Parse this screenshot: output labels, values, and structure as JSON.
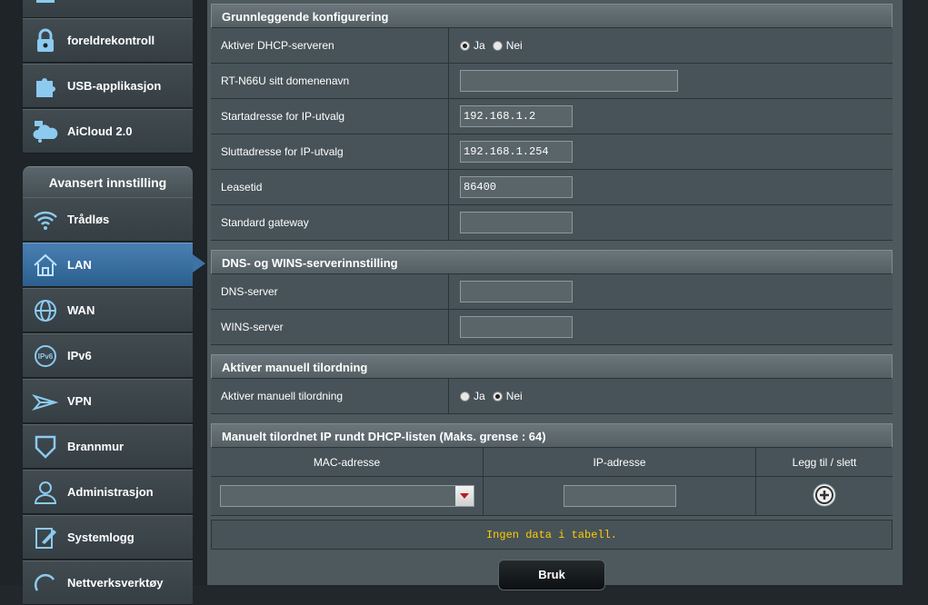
{
  "sidebar": {
    "top_items": [
      {
        "label": "",
        "icon": "partial-icon"
      },
      {
        "label": "foreldrekontroll",
        "icon": "lock-icon"
      },
      {
        "label": "USB-applikasjon",
        "icon": "puzzle-icon"
      },
      {
        "label": "AiCloud 2.0",
        "icon": "cloud-icon"
      }
    ],
    "advanced_header": "Avansert innstilling",
    "items": [
      {
        "label": "Trådløs",
        "icon": "wifi-icon"
      },
      {
        "label": "LAN",
        "icon": "home-icon",
        "active": true
      },
      {
        "label": "WAN",
        "icon": "globe-icon"
      },
      {
        "label": "IPv6",
        "icon": "ipv6-icon"
      },
      {
        "label": "VPN",
        "icon": "vpn-icon"
      },
      {
        "label": "Brannmur",
        "icon": "shield-icon"
      },
      {
        "label": "Administrasjon",
        "icon": "user-icon"
      },
      {
        "label": "Systemlogg",
        "icon": "log-icon"
      },
      {
        "label": "Nettverksverktøy",
        "icon": "tools-icon"
      }
    ]
  },
  "basic": {
    "title": "Grunnleggende konfigurering",
    "dhcp_label": "Aktiver DHCP-serveren",
    "dhcp_yes": "Ja",
    "dhcp_no": "Nei",
    "domain_label": "RT-N66U sitt domenenavn",
    "domain_value": "",
    "start_label": "Startadresse for IP-utvalg",
    "start_value": "192.168.1.2",
    "end_label": "Sluttadresse for IP-utvalg",
    "end_value": "192.168.1.254",
    "lease_label": "Leasetid",
    "lease_value": "86400",
    "gateway_label": "Standard gateway",
    "gateway_value": ""
  },
  "dns": {
    "title": "DNS- og WINS-serverinnstilling",
    "dns_label": "DNS-server",
    "dns_value": "",
    "wins_label": "WINS-server",
    "wins_value": ""
  },
  "manual": {
    "title": "Aktiver manuell tilordning",
    "label": "Aktiver manuell tilordning",
    "yes": "Ja",
    "no": "Nei"
  },
  "list": {
    "title": "Manuelt tilordnet IP rundt DHCP-listen (Maks. grense : 64)",
    "col_mac": "MAC-adresse",
    "col_ip": "IP-adresse",
    "col_action": "Legg til / slett",
    "empty": "Ingen data i tabell."
  },
  "apply_label": "Bruk",
  "colors": {
    "accent": "#3d73a5",
    "nodata": "#ffcc00"
  }
}
